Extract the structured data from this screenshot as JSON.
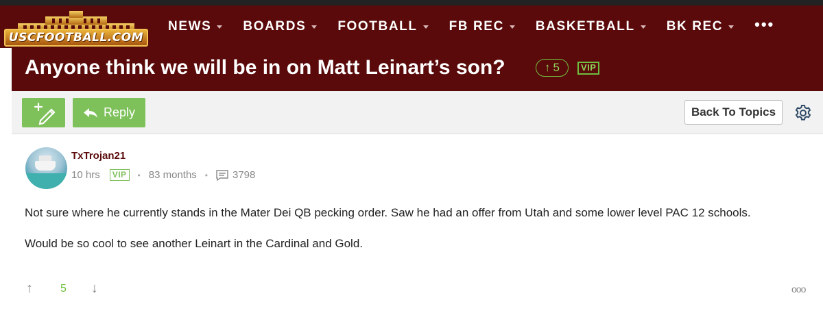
{
  "site": {
    "logo_text": "USCFOOTBALL.COM"
  },
  "nav": {
    "items": [
      {
        "label": "NEWS"
      },
      {
        "label": "BOARDS"
      },
      {
        "label": "FOOTBALL"
      },
      {
        "label": "FB REC"
      },
      {
        "label": "BASKETBALL"
      },
      {
        "label": "BK REC"
      }
    ],
    "more_label": "•••"
  },
  "thread": {
    "title": "Anyone think we will be in on Matt Leinart’s son?",
    "votes": "5",
    "vip_badge": "VIP"
  },
  "toolbar": {
    "reply_label": "Reply",
    "back_label": "Back To Topics"
  },
  "post": {
    "username": "TxTrojan21",
    "time_ago": "10 hrs",
    "vip_badge": "VIP",
    "membership": "83 months",
    "message_count": "3798",
    "paragraphs": [
      "Not sure where he currently stands in the Mater Dei QB pecking order. Saw he had an offer from Utah and some lower level PAC 12 schools.",
      "Would be so cool to see another Leinart in the Cardinal and Gold."
    ],
    "vote_count": "5",
    "up_arrow": "↑",
    "down_arrow": "↓",
    "more_dots": "ooo"
  },
  "colors": {
    "brand_maroon": "#5a0a0a",
    "accent_green": "#7ec15a",
    "title_text": "#ffffff"
  }
}
